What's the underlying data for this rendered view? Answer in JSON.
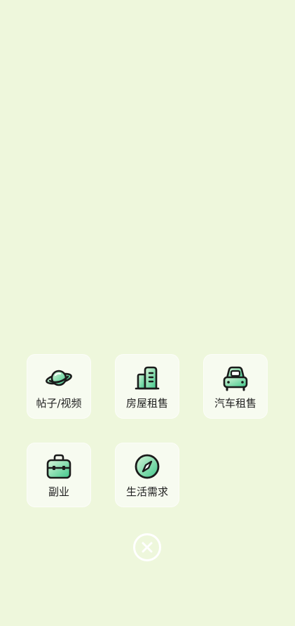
{
  "menu": {
    "items": [
      {
        "label": "帖子/视频",
        "icon": "planet-icon"
      },
      {
        "label": "房屋租售",
        "icon": "building-icon"
      },
      {
        "label": "汽车租售",
        "icon": "car-icon"
      },
      {
        "label": "副业",
        "icon": "briefcase-icon"
      },
      {
        "label": "生活需求",
        "icon": "compass-icon"
      }
    ]
  },
  "colors": {
    "background": "#EEF7DC",
    "tile": "#F7FBF0",
    "icon_stroke": "#1B1B1B",
    "icon_gradient_start": "#BFEFC6",
    "icon_gradient_end": "#3FC78A",
    "close": "#FFFFFF"
  },
  "close_button": {
    "icon": "close-icon"
  }
}
